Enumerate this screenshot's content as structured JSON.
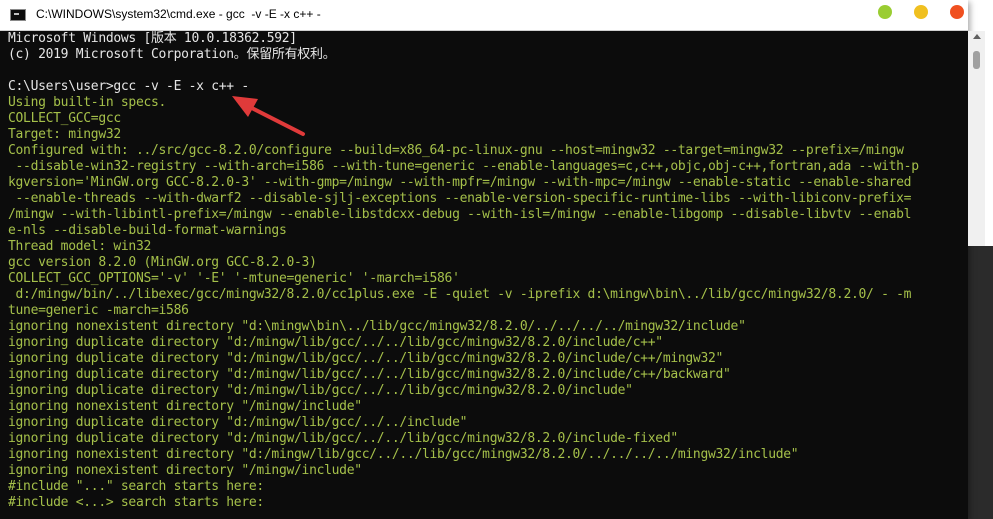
{
  "window": {
    "title": "C:\\WINDOWS\\system32\\cmd.exe - gcc  -v -E -x c++ -",
    "controls": [
      "minimize-dot",
      "maximize-dot",
      "close-dot"
    ],
    "colors": {
      "console_bg": "#0c0c0c",
      "text": "#a5c04a",
      "prompt": "#e6e6e6",
      "annotation_arrow": "#e03a3a"
    }
  },
  "console": {
    "lines": [
      "Microsoft Windows [版本 10.0.18362.592]",
      "(c) 2019 Microsoft Corporation。保留所有权利。",
      "",
      "C:\\Users\\user>gcc -v -E -x c++ -",
      "Using built-in specs.",
      "COLLECT_GCC=gcc",
      "Target: mingw32",
      "Configured with: ../src/gcc-8.2.0/configure --build=x86_64-pc-linux-gnu --host=mingw32 --target=mingw32 --prefix=/mingw",
      " --disable-win32-registry --with-arch=i586 --with-tune=generic --enable-languages=c,c++,objc,obj-c++,fortran,ada --with-p",
      "kgversion='MinGW.org GCC-8.2.0-3' --with-gmp=/mingw --with-mpfr=/mingw --with-mpc=/mingw --enable-static --enable-shared",
      " --enable-threads --with-dwarf2 --disable-sjlj-exceptions --enable-version-specific-runtime-libs --with-libiconv-prefix=",
      "/mingw --with-libintl-prefix=/mingw --enable-libstdcxx-debug --with-isl=/mingw --enable-libgomp --disable-libvtv --enabl",
      "e-nls --disable-build-format-warnings",
      "Thread model: win32",
      "gcc version 8.2.0 (MinGW.org GCC-8.2.0-3)",
      "COLLECT_GCC_OPTIONS='-v' '-E' '-mtune=generic' '-march=i586'",
      " d:/mingw/bin/../libexec/gcc/mingw32/8.2.0/cc1plus.exe -E -quiet -v -iprefix d:\\mingw\\bin\\../lib/gcc/mingw32/8.2.0/ - -m",
      "tune=generic -march=i586",
      "ignoring nonexistent directory \"d:\\mingw\\bin\\../lib/gcc/mingw32/8.2.0/../../../../mingw32/include\"",
      "ignoring duplicate directory \"d:/mingw/lib/gcc/../../lib/gcc/mingw32/8.2.0/include/c++\"",
      "ignoring duplicate directory \"d:/mingw/lib/gcc/../../lib/gcc/mingw32/8.2.0/include/c++/mingw32\"",
      "ignoring duplicate directory \"d:/mingw/lib/gcc/../../lib/gcc/mingw32/8.2.0/include/c++/backward\"",
      "ignoring duplicate directory \"d:/mingw/lib/gcc/../../lib/gcc/mingw32/8.2.0/include\"",
      "ignoring nonexistent directory \"/mingw/include\"",
      "ignoring duplicate directory \"d:/mingw/lib/gcc/../../include\"",
      "ignoring duplicate directory \"d:/mingw/lib/gcc/../../lib/gcc/mingw32/8.2.0/include-fixed\"",
      "ignoring nonexistent directory \"d:/mingw/lib/gcc/../../lib/gcc/mingw32/8.2.0/../../../../mingw32/include\"",
      "ignoring nonexistent directory \"/mingw/include\"",
      "#include \"...\" search starts here:",
      "#include <...> search starts here:"
    ]
  }
}
